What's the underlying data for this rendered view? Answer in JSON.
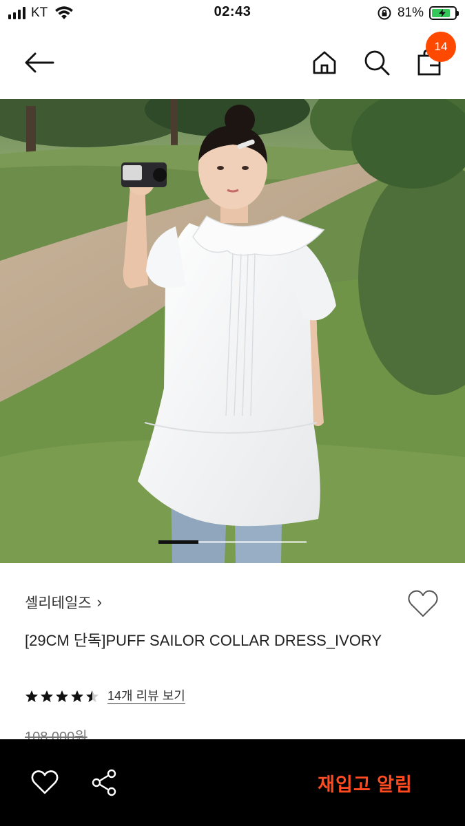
{
  "status_bar": {
    "carrier": "KT",
    "time": "02:43",
    "battery_percent": "81%",
    "battery_level": 0.81,
    "icons": [
      "signal-icon",
      "wifi-icon",
      "orientation-lock-icon",
      "battery-icon"
    ]
  },
  "nav": {
    "icons": [
      "back-arrow-icon",
      "home-icon",
      "search-icon",
      "shopping-bag-icon"
    ],
    "cart_count": "14",
    "badge_color": "#ff4800"
  },
  "gallery": {
    "current_slide_fraction": 0.27
  },
  "product": {
    "brand": "셀리테일즈",
    "brand_chevron": "›",
    "title": "[29CM 단독]PUFF SAILOR COLLAR DRESS_IVORY",
    "rating_stars": 4.5,
    "review_link": "14개 리뷰 보기",
    "original_price": "108,000원"
  },
  "bottom_bar": {
    "icons": [
      "heart-icon",
      "share-icon"
    ],
    "restock_button": "재입고 알림",
    "accent_color": "#ff4b1f"
  }
}
